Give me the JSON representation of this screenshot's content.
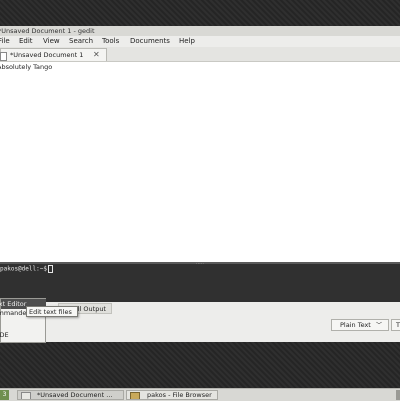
{
  "window": {
    "title": "*Unsaved Document 1 - gedit"
  },
  "menubar": {
    "items": [
      "File",
      "Edit",
      "View",
      "Search",
      "Tools",
      "Documents",
      "Help"
    ]
  },
  "tabs": [
    {
      "label": "*Unsaved Document 1",
      "close": "✕"
    }
  ],
  "editor": {
    "text": "Absolutely Tango"
  },
  "terminal": {
    "prompt": "pakos@dell:~$"
  },
  "bottom_pane": {
    "shell_output_label": "Shell Output"
  },
  "statusbar": {
    "language": "Plain Text",
    "tab_width": "T"
  },
  "popup_menu": {
    "items": [
      "Text Editor",
      "Commander",
      "",
      "",
      "ADE"
    ]
  },
  "tooltip": {
    "text": "Edit text files"
  },
  "taskbar": {
    "workspace": "3",
    "tasks": [
      {
        "label": "*Unsaved Document ..."
      },
      {
        "label": "pakos - File Browser"
      }
    ]
  },
  "colors": {
    "desktop": "#2b2b2b",
    "window_bg": "#ededeb",
    "terminal_bg": "#303030",
    "menu_selection": "#4e4e4e"
  }
}
